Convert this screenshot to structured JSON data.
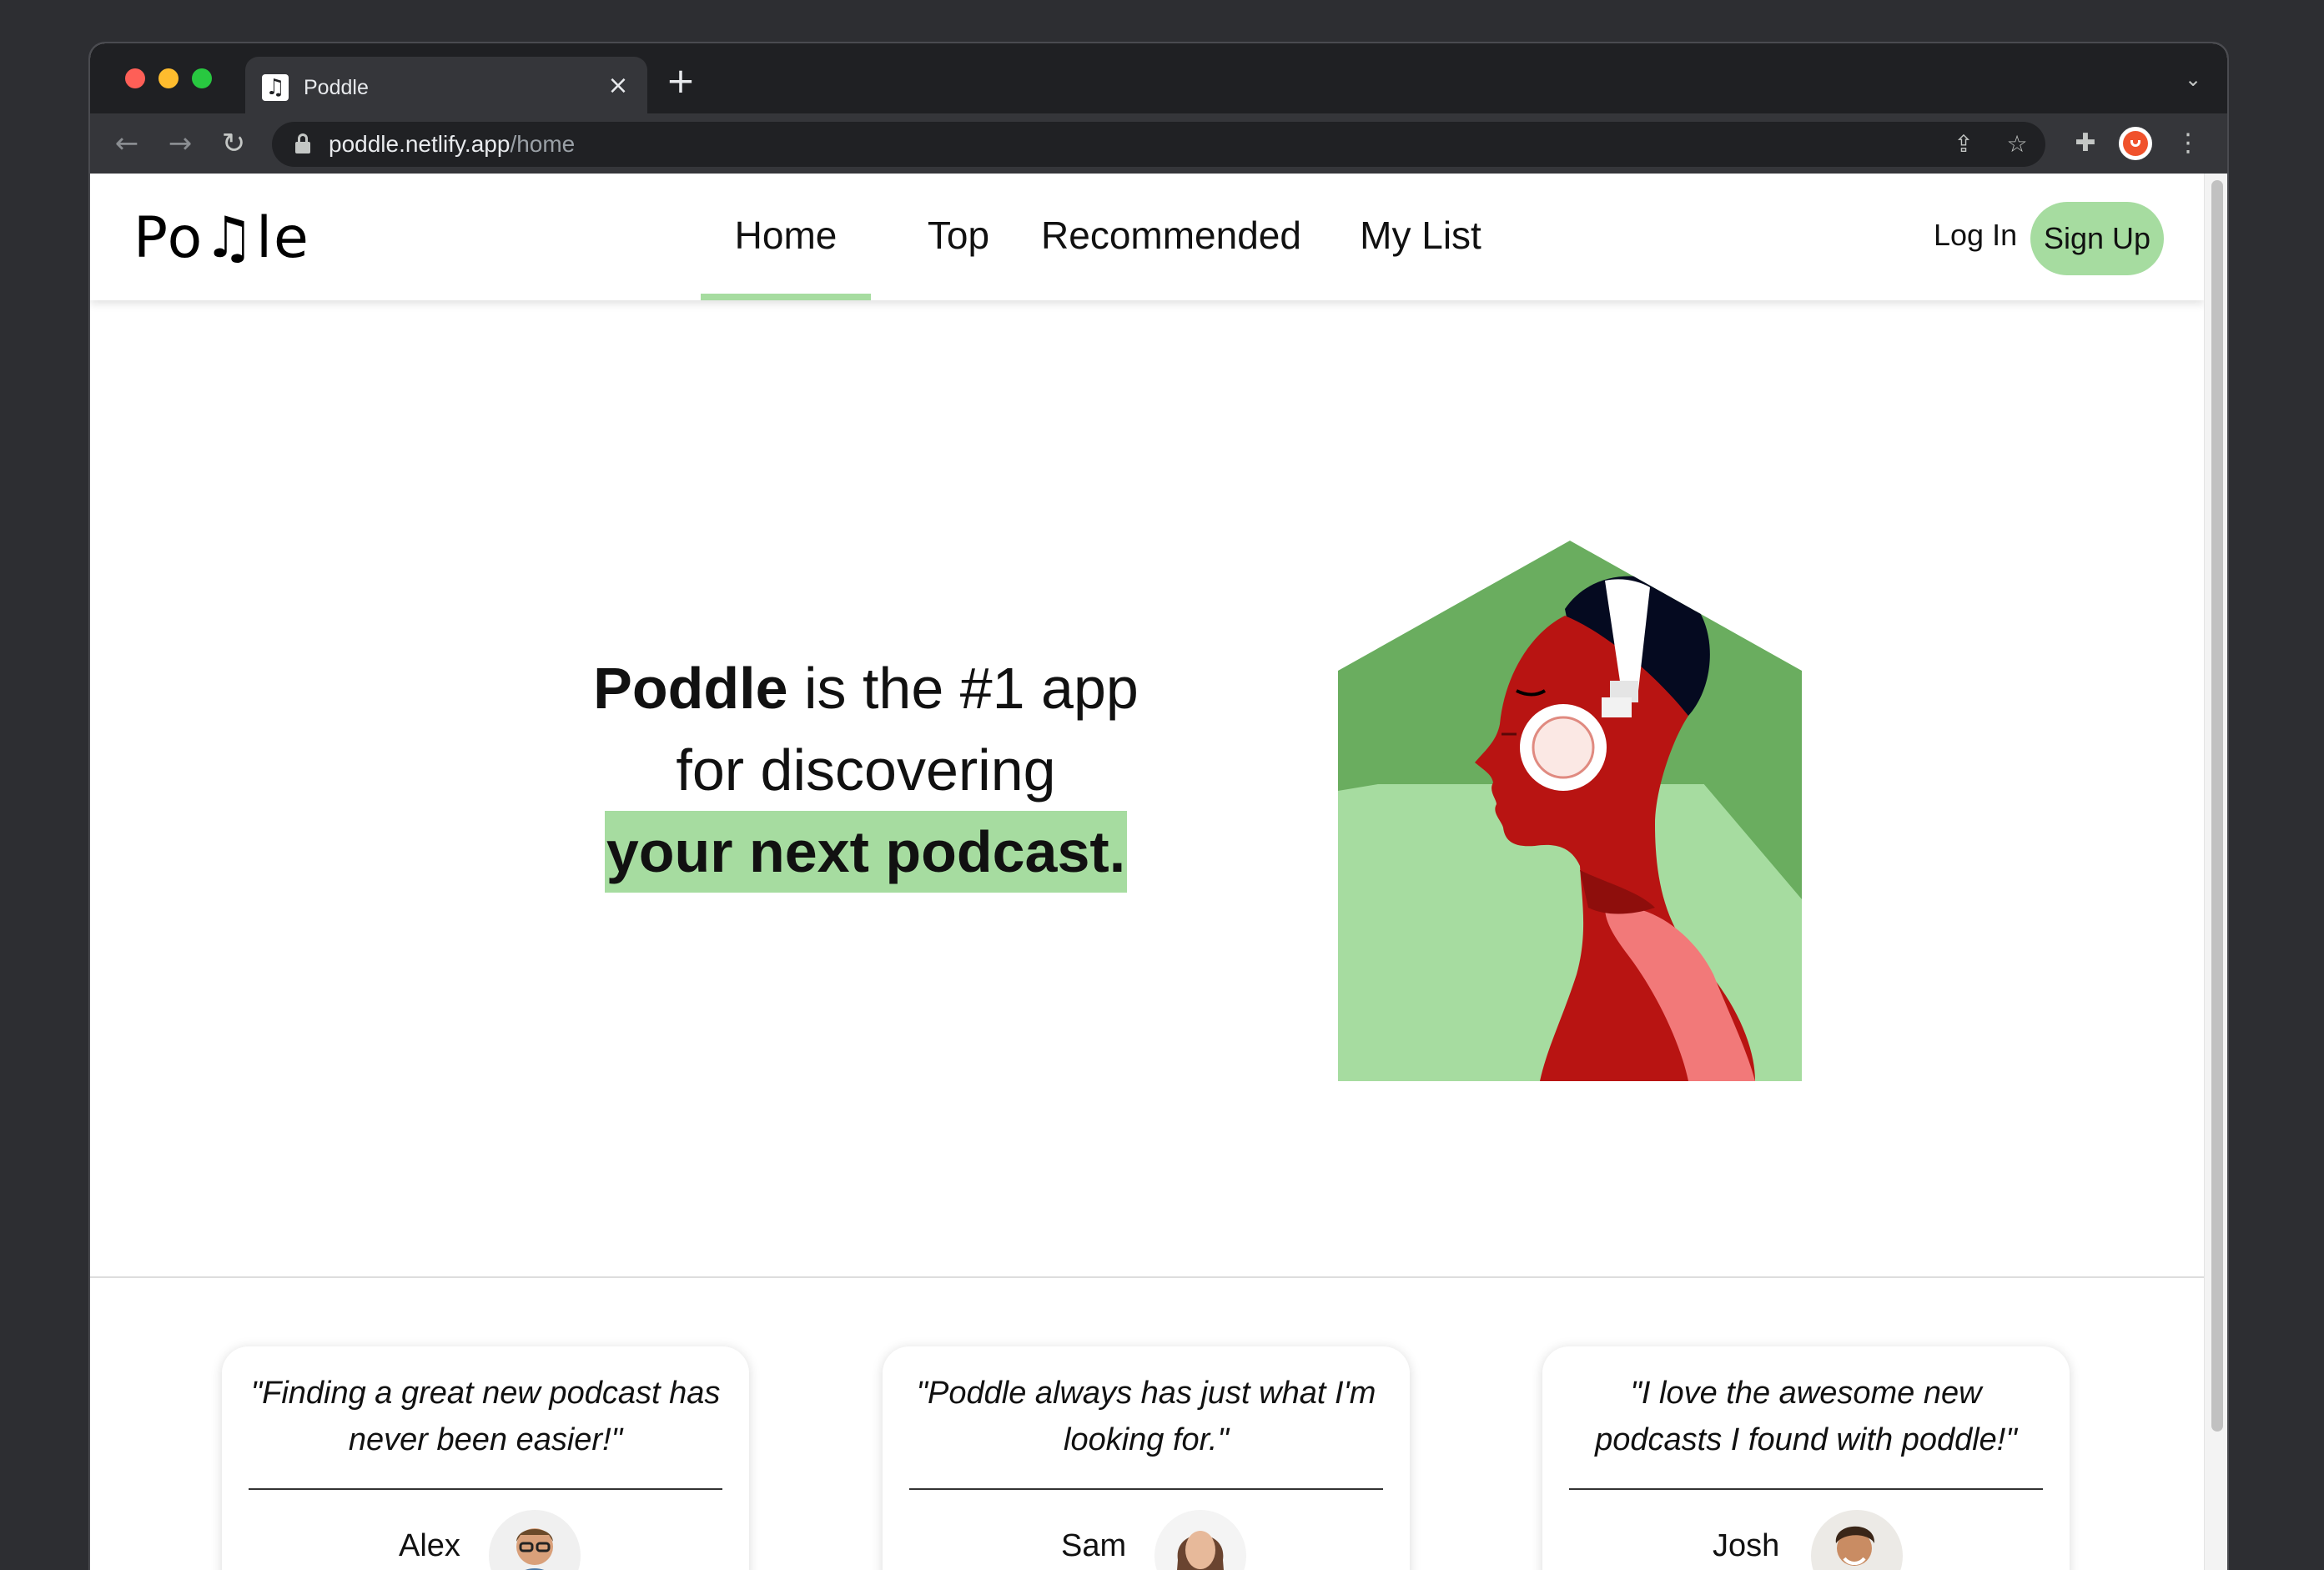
{
  "browser": {
    "tab_title": "Poddle",
    "tab_favicon": "music-note-icon",
    "url_host": "poddle.netlify.app",
    "url_path": "/home",
    "new_tab_glyph": "+",
    "close_glyph": "×"
  },
  "nav": {
    "logo": "Po♫le",
    "links": [
      {
        "label": "Home",
        "active": true
      },
      {
        "label": "Top",
        "active": false
      },
      {
        "label": "Recommended",
        "active": false
      },
      {
        "label": "My List",
        "active": false
      }
    ],
    "login": "Log In",
    "signup": "Sign Up"
  },
  "hero": {
    "brand": "Poddle",
    "line1_rest": " is the #1 app",
    "line2": "for discovering",
    "highlight": "your next podcast."
  },
  "colors": {
    "accent": "#a6dca0",
    "dark_green": "#6aad5f",
    "figure_red": "#b81412"
  },
  "testimonials": [
    {
      "quote": "\"Finding a great new podcast has never been easier!\"",
      "name": "Alex"
    },
    {
      "quote": "\"Poddle always has just what I'm looking for.\"",
      "name": "Sam"
    },
    {
      "quote": "\"I love the awesome new podcasts I found with poddle!\"",
      "name": "Josh"
    }
  ]
}
